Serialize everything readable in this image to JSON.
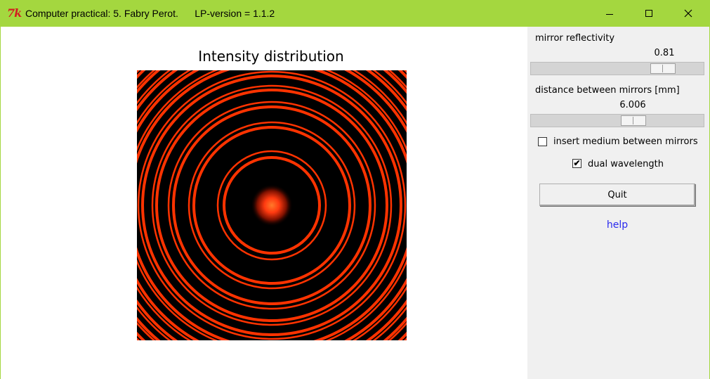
{
  "window": {
    "logo": "7k",
    "title": "Computer practical: 5. Fabry Perot.      LP-version = 1.1.2",
    "minimize_icon": "minimize-icon",
    "maximize_icon": "maximize-icon",
    "close_icon": "close-icon",
    "accent": "#a4d73f"
  },
  "plot": {
    "title": "Intensity distribution",
    "ring_color": "#ff3300",
    "background_color": "#000000",
    "center_color": "#ff5a1a"
  },
  "controls": {
    "reflectivity": {
      "label": "mirror reflectivity",
      "value": "0.81",
      "fraction": 0.81
    },
    "distance": {
      "label": "distance between mirrors [mm]",
      "value": "6.006",
      "fraction": 0.61
    },
    "medium": {
      "label": "insert medium between mirrors",
      "checked": false
    },
    "dual": {
      "label": "dual wavelength",
      "checked": true,
      "check_glyph": "✔"
    },
    "quit_label": "Quit",
    "help_label": "help",
    "help_color": "#2a2aee"
  }
}
